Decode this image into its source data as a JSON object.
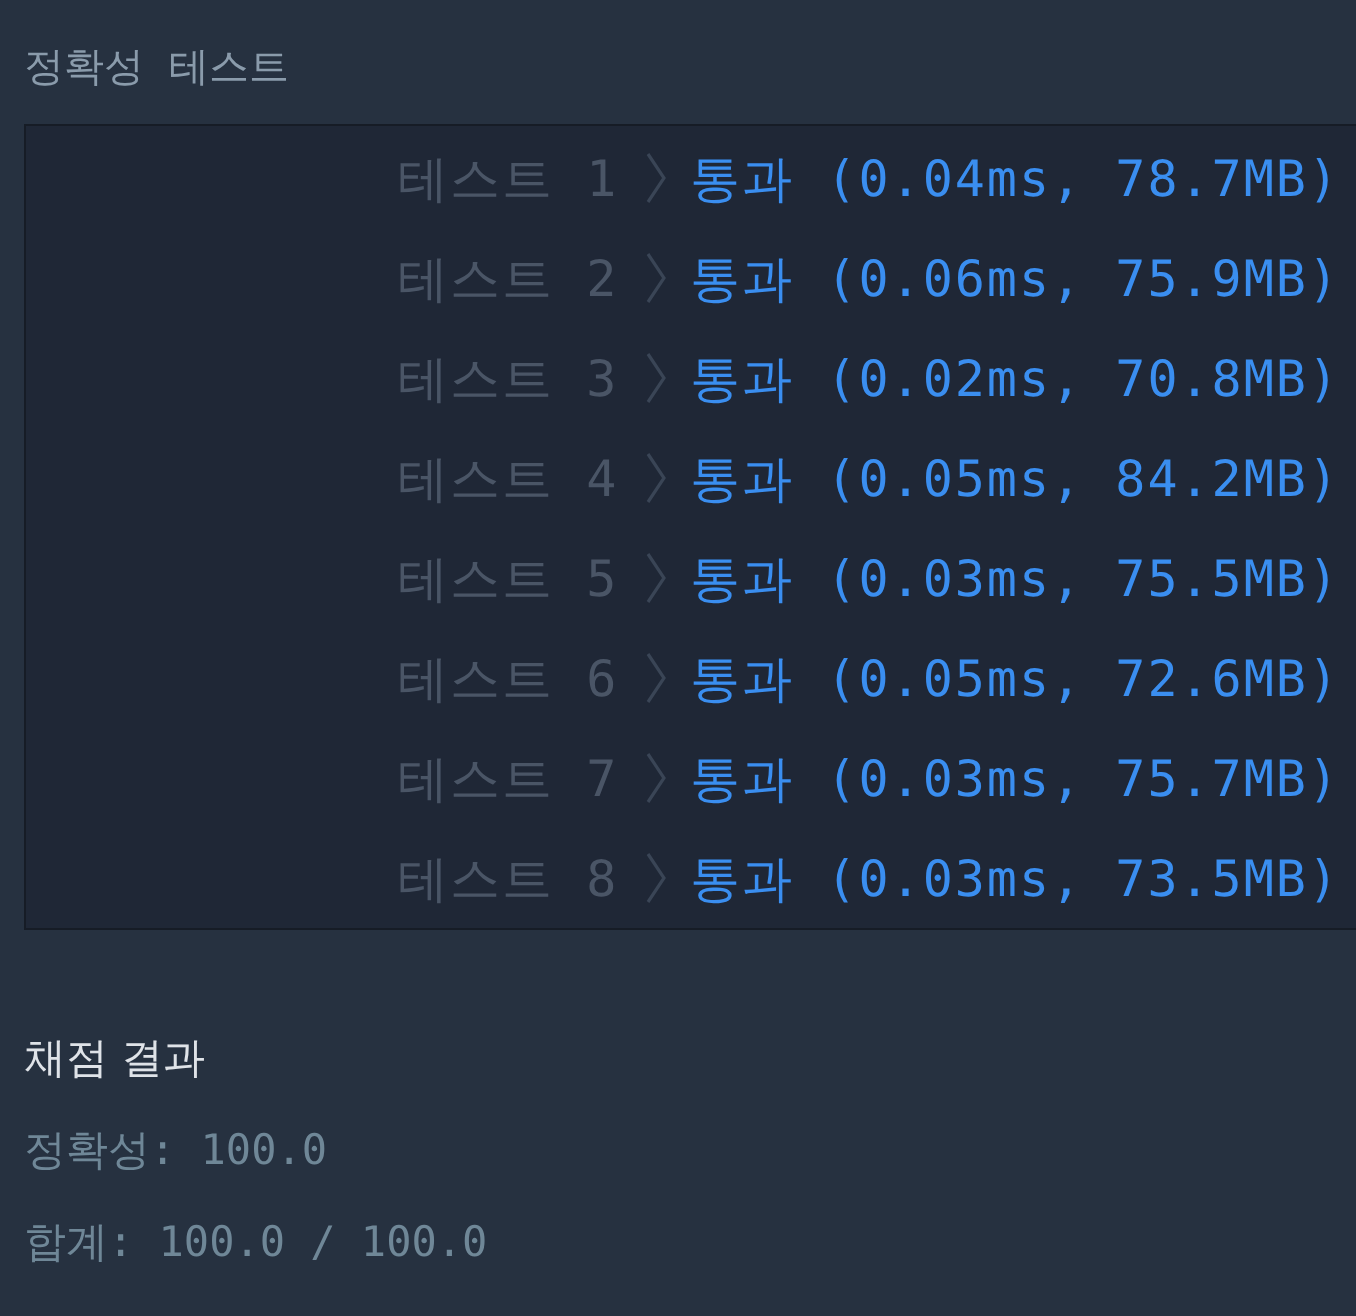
{
  "section_title": "정확성  테스트",
  "tests": [
    {
      "label": "테스트 1",
      "result": "통과 (0.04ms, 78.7MB)"
    },
    {
      "label": "테스트 2",
      "result": "통과 (0.06ms, 75.9MB)"
    },
    {
      "label": "테스트 3",
      "result": "통과 (0.02ms, 70.8MB)"
    },
    {
      "label": "테스트 4",
      "result": "통과 (0.05ms, 84.2MB)"
    },
    {
      "label": "테스트 5",
      "result": "통과 (0.03ms, 75.5MB)"
    },
    {
      "label": "테스트 6",
      "result": "통과 (0.05ms, 72.6MB)"
    },
    {
      "label": "테스트 7",
      "result": "통과 (0.03ms, 75.7MB)"
    },
    {
      "label": "테스트 8",
      "result": "통과 (0.03ms, 73.5MB)"
    }
  ],
  "summary": {
    "title": "채점 결과",
    "lines": [
      "정확성: 100.0",
      "합계: 100.0 / 100.0"
    ]
  }
}
